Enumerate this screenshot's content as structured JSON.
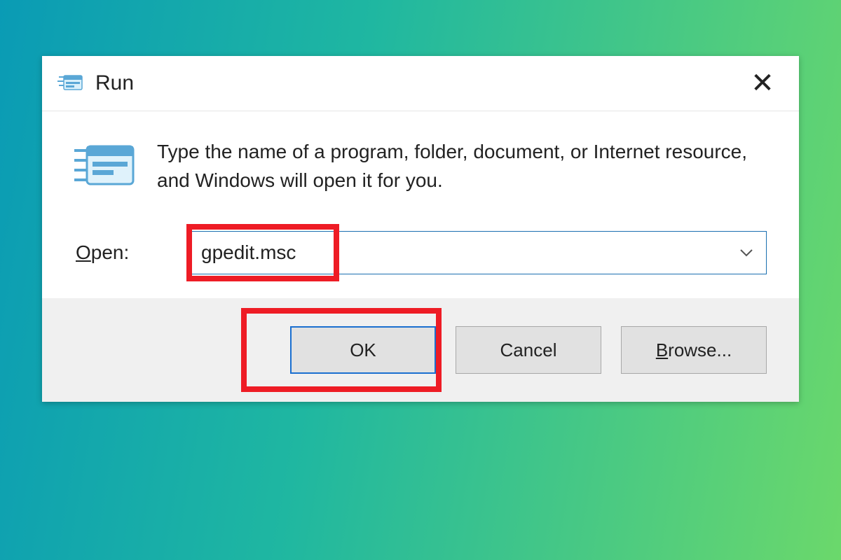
{
  "window": {
    "title": "Run",
    "description": "Type the name of a program, folder, document, or Internet resource, and Windows will open it for you.",
    "open_label_pre": "O",
    "open_label_post": "pen:",
    "open_value": "gpedit.msc",
    "close_glyph": "✕"
  },
  "buttons": {
    "ok": "OK",
    "cancel": "Cancel",
    "browse_pre": "B",
    "browse_post": "rowse..."
  }
}
